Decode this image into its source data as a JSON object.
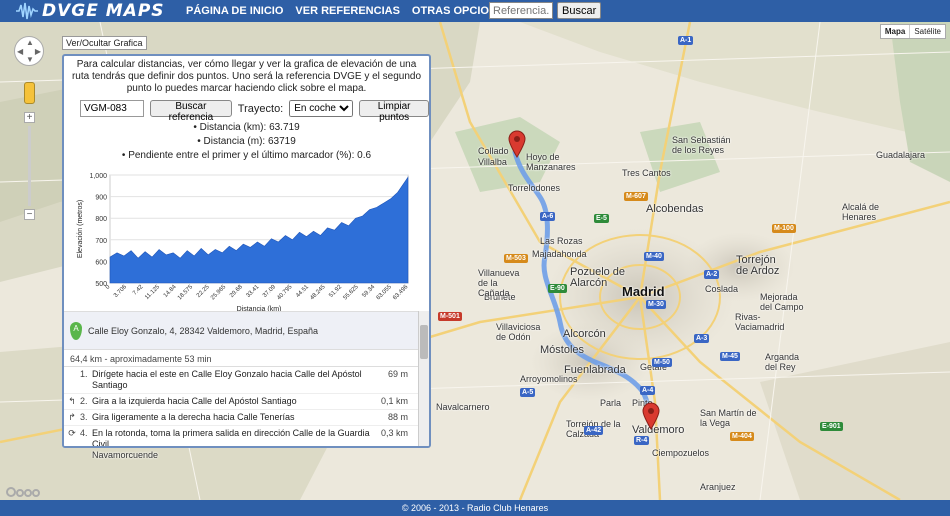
{
  "header": {
    "logo_text": "DVGE MAPS",
    "nav": [
      "PÁGINA DE INICIO",
      "VER REFERENCIAS",
      "OTRAS OPCIONES"
    ],
    "search_placeholder": "Referencia...",
    "search_button": "Buscar"
  },
  "map": {
    "toggle_chart_button": "Ver/Ocultar Grafica",
    "map_types": [
      "Mapa",
      "Satélite"
    ],
    "labels": [
      {
        "t": "Madrid",
        "c": "big"
      },
      {
        "t": "Alcobendas",
        "c": "med"
      },
      {
        "t": "Pozuelo de Alarcón",
        "c": "med"
      },
      {
        "t": "Alcorcón",
        "c": "med"
      },
      {
        "t": "Móstoles",
        "c": "med"
      },
      {
        "t": "Fuenlabrada",
        "c": "med"
      },
      {
        "t": "Valdemoro",
        "c": "med"
      },
      {
        "t": "Torrejón de Ardoz",
        "c": "med"
      },
      {
        "t": "Las Rozas",
        "c": ""
      },
      {
        "t": "Majadahonda",
        "c": ""
      },
      {
        "t": "Torrelodones",
        "c": ""
      },
      {
        "t": "Collado Villalba",
        "c": ""
      },
      {
        "t": "Hoyo de Manzanares",
        "c": ""
      },
      {
        "t": "Tres Cantos",
        "c": ""
      },
      {
        "t": "Guadalajara",
        "c": ""
      },
      {
        "t": "Alcalá de Henares",
        "c": ""
      },
      {
        "t": "Getafe",
        "c": ""
      },
      {
        "t": "Parla",
        "c": ""
      },
      {
        "t": "Pinto",
        "c": ""
      },
      {
        "t": "Ciempozuelos",
        "c": ""
      },
      {
        "t": "Arganda del Rey",
        "c": ""
      },
      {
        "t": "Rivas-Vaciamadrid",
        "c": ""
      },
      {
        "t": "Brunete",
        "c": ""
      },
      {
        "t": "Navalcarnero",
        "c": ""
      },
      {
        "t": "Villaviciosa de Odón",
        "c": ""
      },
      {
        "t": "San Sebastián de los Reyes",
        "c": ""
      },
      {
        "t": "Coslada",
        "c": ""
      },
      {
        "t": "San Martín de la Vega",
        "c": ""
      },
      {
        "t": "Torrejón de la Calzada",
        "c": ""
      },
      {
        "t": "Arroyomolinos",
        "c": ""
      },
      {
        "t": "Villanueva de la Cañada",
        "c": ""
      },
      {
        "t": "Mejorada del Campo",
        "c": ""
      },
      {
        "t": "Navamorcuende",
        "c": ""
      },
      {
        "t": "Aranjuez",
        "c": ""
      }
    ],
    "shields": [
      {
        "t": "A-1",
        "c": "b"
      },
      {
        "t": "M-607",
        "c": "o"
      },
      {
        "t": "A-6",
        "c": "b"
      },
      {
        "t": "M-503",
        "c": "o"
      },
      {
        "t": "M-40",
        "c": "b"
      },
      {
        "t": "M-30",
        "c": "b"
      },
      {
        "t": "A-2",
        "c": "b"
      },
      {
        "t": "M-50",
        "c": "b"
      },
      {
        "t": "A-4",
        "c": "b"
      },
      {
        "t": "A-42",
        "c": "b"
      },
      {
        "t": "R-4",
        "c": "b"
      },
      {
        "t": "A-3",
        "c": "b"
      },
      {
        "t": "M-501",
        "c": "r"
      },
      {
        "t": "E-90",
        "c": "g"
      },
      {
        "t": "E-5",
        "c": "g"
      },
      {
        "t": "M-100",
        "c": "o"
      },
      {
        "t": "M-45",
        "c": "b"
      },
      {
        "t": "E-901",
        "c": "g"
      },
      {
        "t": "A-5",
        "c": "b"
      },
      {
        "t": "M-404",
        "c": "o"
      }
    ]
  },
  "panel": {
    "intro": "Para calcular distancias, ver cómo llegar y ver la grafica de elevación de una ruta tendrás que definir dos puntos. Uno será la referencia DVGE y el segundo punto lo puedes marcar haciendo click sobre el mapa.",
    "ref_value": "VGM-083",
    "search_ref_button": "Buscar referencia",
    "route_label": "Trayecto:",
    "route_mode": "En coche",
    "clear_button": "Limpiar puntos",
    "distance_km": "Distancia (km): 63.719",
    "distance_m": "Distancia (m): 63719",
    "slope": "Pendiente entre el primer y el último marcador (%): 0.6"
  },
  "chart_data": {
    "type": "area",
    "title": "",
    "xlabel": "Distancia (km)",
    "ylabel": "Elevación (metros)",
    "ylim": [
      500,
      1000
    ],
    "y_ticks": [
      500,
      600,
      700,
      800,
      900,
      1000
    ],
    "y_tick_labels": [
      "500",
      "600",
      "700",
      "800",
      "900",
      "1,000"
    ],
    "x_tick_labels": [
      "0",
      "3.706",
      "7.42",
      "11.125",
      "14.84",
      "18.575",
      "22.25",
      "25.965",
      "29.68",
      "33.41",
      "37.09",
      "40.795",
      "44.51",
      "48.245",
      "51.92",
      "55.625",
      "59.34",
      "63.055",
      "63.496"
    ],
    "x": [
      0,
      1.5,
      3,
      4.5,
      6,
      7.5,
      9,
      10.5,
      12,
      13.5,
      15,
      16.5,
      18,
      19.5,
      21,
      22.5,
      24,
      25.5,
      27,
      28.5,
      30,
      31.5,
      33,
      34.5,
      36,
      37.5,
      39,
      40.5,
      42,
      43.5,
      45,
      46.5,
      48,
      49.5,
      51,
      52.5,
      54,
      55.5,
      57,
      58.5,
      60,
      61.5,
      63.7
    ],
    "values": [
      620,
      640,
      625,
      650,
      615,
      645,
      620,
      655,
      630,
      640,
      615,
      650,
      625,
      660,
      630,
      655,
      640,
      670,
      650,
      680,
      665,
      690,
      670,
      705,
      690,
      720,
      700,
      735,
      715,
      740,
      720,
      755,
      745,
      780,
      765,
      800,
      810,
      840,
      850,
      870,
      890,
      920,
      990
    ],
    "grid": true
  },
  "directions": {
    "start_address": "Calle Eloy Gonzalo, 4, 28342 Valdemoro, Madrid, España",
    "start_marker": "A",
    "summary": "64,4 km - aproximadamente 53 min",
    "steps": [
      {
        "num": "1.",
        "icon": "",
        "text": "Dirígete hacia el este en Calle Eloy Gonzalo hacia Calle del Apóstol Santiago",
        "dist": "69 m"
      },
      {
        "num": "2.",
        "icon": "↰",
        "text": "Gira a la izquierda hacia Calle del Apóstol Santiago",
        "dist": "0,1 km"
      },
      {
        "num": "3.",
        "icon": "↱",
        "text": "Gira ligeramente a la derecha hacia Calle Tenerías",
        "dist": "88 m"
      },
      {
        "num": "4.",
        "icon": "⟳",
        "text": "En la rotonda, toma la primera salida en dirección Calle de la Guardia Civil",
        "dist": "0,3 km"
      }
    ]
  },
  "footer": {
    "text": "© 2006 - 2013 - Radio Club Henares"
  },
  "colors": {
    "topbar": "#2e5fa6",
    "chart_fill": "#2e6fd8",
    "route": "#6f9ee8",
    "marker": "#d93a30"
  }
}
